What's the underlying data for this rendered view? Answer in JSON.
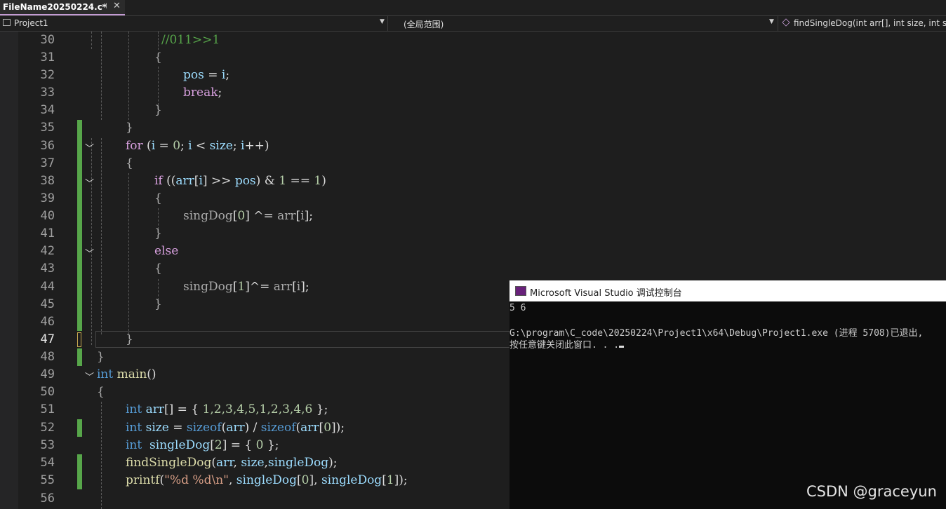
{
  "tab": {
    "title": "FileName20250224.c*",
    "pin_glyph": "⊣",
    "close_glyph": "✕"
  },
  "nav": {
    "project": "Project1",
    "scope": "(全局范围)",
    "function": "findSingleDog(int arr[], int size, int sin"
  },
  "lines": {
    "n30": "30",
    "n31": "31",
    "n32": "32",
    "n33": "33",
    "n34": "34",
    "n35": "35",
    "n36": "36",
    "n37": "37",
    "n38": "38",
    "n39": "39",
    "n40": "40",
    "n41": "41",
    "n42": "42",
    "n43": "43",
    "n44": "44",
    "n45": "45",
    "n46": "46",
    "n47": "47",
    "n48": "48",
    "n49": "49",
    "n50": "50",
    "n51": "51",
    "n52": "52",
    "n53": "53",
    "n54": "54",
    "n55": "55",
    "n56": "56"
  },
  "code": {
    "c30": "//011>>1",
    "c32_var": "pos",
    "c32_op": " = ",
    "c32_i": "i",
    "c32_end": ";",
    "c33_kw": "break",
    "c36_for": "for",
    "c36_a": " (",
    "c36_i1": "i",
    "c36_b": " = ",
    "c36_0": "0",
    "c36_c": "; ",
    "c36_i2": "i",
    "c36_d": " < ",
    "c36_size": "size",
    "c36_e": "; ",
    "c36_i3": "i",
    "c36_f": "++)",
    "c38_if": "if",
    "c38_a": " ((",
    "c38_arr": "arr",
    "c38_b": "[",
    "c38_i": "i",
    "c38_c": "] >> ",
    "c38_pos": "pos",
    "c38_d": ") & ",
    "c38_1a": "1",
    "c38_e": " == ",
    "c38_1b": "1",
    "c38_f": ")",
    "c40_sd": "singDog",
    "c40_a": "[",
    "c40_0": "0",
    "c40_b": "] ^= ",
    "c40_arr": "arr",
    "c40_c": "[",
    "c40_i": "i",
    "c40_d": "];",
    "c42_else": "else",
    "c44_sd": "singDog",
    "c44_a": "[",
    "c44_1": "1",
    "c44_b": "]^= ",
    "c44_arr": "arr",
    "c44_c": "[",
    "c44_i": "i",
    "c44_d": "];",
    "c49_int": "int",
    "c49_main": " main",
    "c49_p": "()",
    "c51_int": "int",
    "c51_arr": " arr",
    "c51_a": "[] = { ",
    "c51_nums": "1,2,3,4,5,1,2,3,4,6",
    "c51_b": " };",
    "c52_int": "int",
    "c52_size": " size",
    "c52_a": " = ",
    "c52_sizeof1": "sizeof",
    "c52_b": "(",
    "c52_arr1": "arr",
    "c52_c": ") / ",
    "c52_sizeof2": "sizeof",
    "c52_d": "(",
    "c52_arr2": "arr",
    "c52_e": "[",
    "c52_0": "0",
    "c52_f": "]);",
    "c53_int": "int",
    "c53_sd": "  singleDog",
    "c53_a": "[",
    "c53_2": "2",
    "c53_b": "] = { ",
    "c53_0": "0",
    "c53_c": " };",
    "c54_fn": "findSingleDog",
    "c54_a": "(",
    "c54_arr": "arr",
    "c54_b": ", ",
    "c54_size": "size",
    "c54_c": ",",
    "c54_sd": "singleDog",
    "c54_d": ");",
    "c55_fn": "printf",
    "c55_a": "(",
    "c55_str": "\"%d %d\\n\"",
    "c55_b": ", ",
    "c55_sd1": "singleDog",
    "c55_c": "[",
    "c55_0": "0",
    "c55_d": "], ",
    "c55_sd2": "singleDog",
    "c55_e": "[",
    "c55_1": "1",
    "c55_f": "]);"
  },
  "console": {
    "title": "Microsoft Visual Studio 调试控制台",
    "output": "5 6",
    "exit_line": "G:\\program\\C_code\\20250224\\Project1\\x64\\Debug\\Project1.exe (进程 5708)已退出,",
    "close_hint": "按任意键关闭此窗口. . ."
  },
  "watermark": "CSDN @graceyun",
  "colors": {
    "keyword": "#569cd6",
    "control": "#d8a0df",
    "variable": "#9cdcfe",
    "number": "#b5cea8",
    "function": "#dcdcaa",
    "comment": "#57a64a",
    "changebar": "#57a64a"
  }
}
